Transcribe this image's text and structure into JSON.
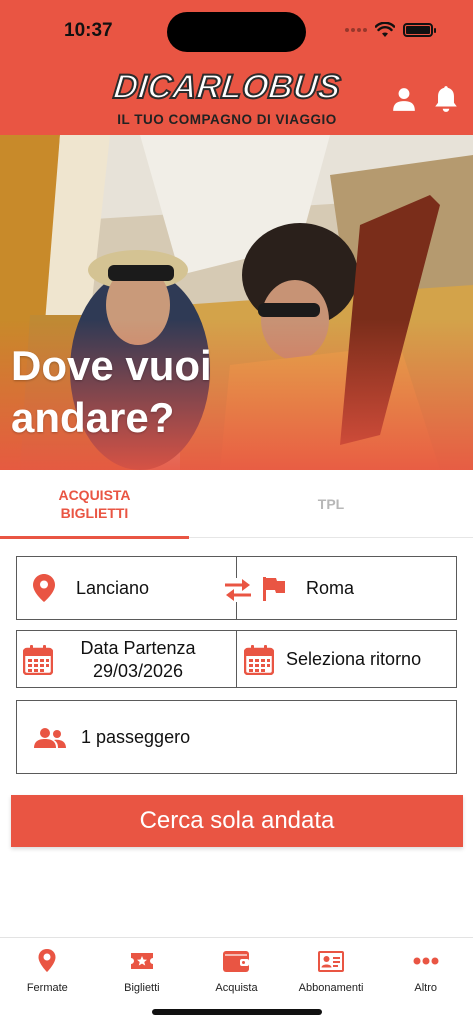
{
  "status_bar": {
    "time": "10:37",
    "battery_level": 1.0
  },
  "header": {
    "logo_text": "DICARLOBUS",
    "tagline": "IL TUO COMPAGNO DI VIAGGIO",
    "user_icon": "user-icon",
    "bell_icon": "bell-icon",
    "accent_color": "#e95543"
  },
  "hero": {
    "title_line1": "Dove vuoi",
    "title_line2": "andare?"
  },
  "tabs": [
    {
      "label_line1": "ACQUISTA",
      "label_line2": "BIGLIETTI",
      "active": true
    },
    {
      "label": "TPL",
      "active": false
    }
  ],
  "form": {
    "from": "Lanciano",
    "to": "Roma",
    "departure_label": "Data Partenza",
    "departure_date": "29/03/2026",
    "return_label": "Seleziona ritorno",
    "passengers": "1 passeggero"
  },
  "search_button": "Cerca sola andata",
  "bottom_nav": [
    {
      "label": "Fermate",
      "icon": "map-pin-icon"
    },
    {
      "label": "Biglietti",
      "icon": "ticket-icon"
    },
    {
      "label": "Acquista",
      "icon": "wallet-icon"
    },
    {
      "label": "Abbonamenti",
      "icon": "id-card-icon"
    },
    {
      "label": "Altro",
      "icon": "more-dots-icon"
    }
  ]
}
